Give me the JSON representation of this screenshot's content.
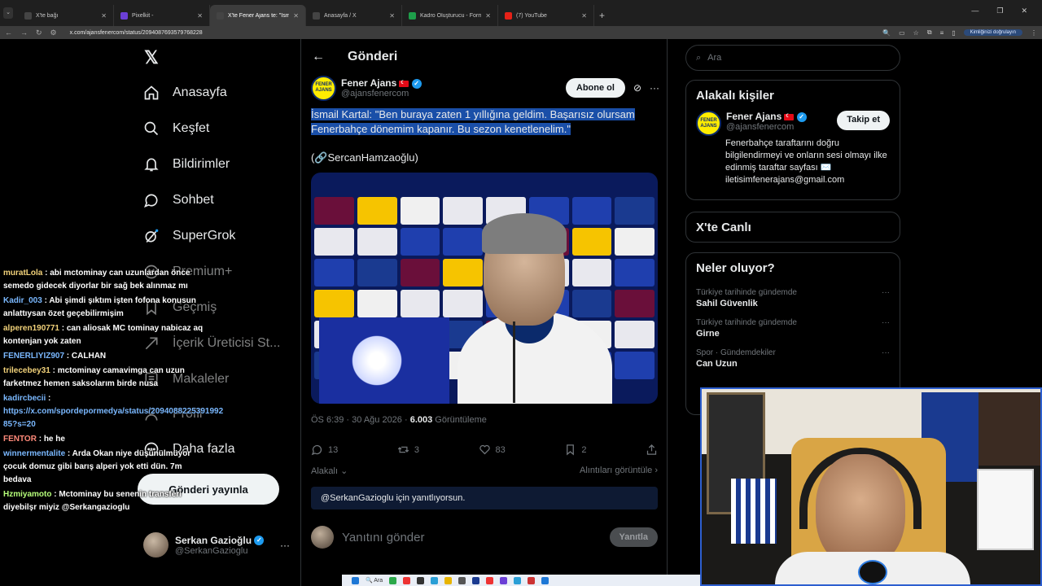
{
  "browser": {
    "tabs": [
      {
        "title": "X'te bağı",
        "color": "#222"
      },
      {
        "title": "Pixelkit -",
        "color": "#6b3fd6"
      },
      {
        "title": "X'te Fener Ajans te: \"İsmail Kart",
        "color": "#222"
      },
      {
        "title": "Anasayfa / X",
        "color": "#222"
      },
      {
        "title": "Kadro Oluşturucu - Formasyon",
        "color": "#1e9e4a"
      },
      {
        "title": "(7) YouTube",
        "color": "#e62117"
      }
    ],
    "new_tab": "+",
    "url": "x.com/ajansfenercom/status/2094087693579768228",
    "profile_label": "Kimliğinizi doğrulayın"
  },
  "nav": {
    "items": [
      {
        "label": "Anasayfa",
        "icon": "home-icon"
      },
      {
        "label": "Keşfet",
        "icon": "search-icon"
      },
      {
        "label": "Bildirimler",
        "icon": "bell-icon"
      },
      {
        "label": "Sohbet",
        "icon": "chat-icon"
      },
      {
        "label": "SuperGrok",
        "icon": "grok-icon"
      },
      {
        "label": "Premium+",
        "icon": "x-premium-icon"
      },
      {
        "label": "Geçmiş",
        "icon": "bookmark-icon"
      },
      {
        "label": "İçerik Üreticisi St...",
        "icon": "rocket-icon"
      },
      {
        "label": "Makaleler",
        "icon": "article-icon"
      },
      {
        "label": "Profil",
        "icon": "profile-icon"
      },
      {
        "label": "Daha fazla",
        "icon": "more-icon"
      }
    ],
    "post_button": "Gönderi yayınla",
    "account": {
      "name": "Serkan Gazioğlu",
      "handle": "@SerkanGazioglu",
      "more": "···"
    }
  },
  "chat": [
    {
      "user": "muratLola",
      "color": "#f2d27a",
      "text": "abi mctominay can uzunlardan önce semedo gidecek diyorlar bir sağ bek alınmaz mı"
    },
    {
      "user": "Kadir_003",
      "color": "#7ab8ff",
      "text": "Abi şimdi şıktım işten fofona konusun anlattıysan özet geçebilirmişim"
    },
    {
      "user": "alperen190771",
      "color": "#f2d27a",
      "text": "can aliosak MC tominay nabicaz aq kontenjan yok zaten"
    },
    {
      "user": "FENERLIYIZ907",
      "color": "#7ab8ff",
      "text": "CALHAN"
    },
    {
      "user": "trilecebey31",
      "color": "#f2d27a",
      "text": "mctominay camavimga can uzun farketmez hemen saksolarım birde nusa"
    },
    {
      "user": "kadircbecii",
      "color": "#7ab8ff",
      "text": "https://x.com/spordepormedya/status/2094088225391992​85?s=20"
    },
    {
      "user": "FENTOR",
      "color": "#ff8a7a",
      "text": "he he"
    },
    {
      "user": "winnermentalite",
      "color": "#7ab8ff",
      "text": "Arda Okan niye düşünülmüyor çocuk domuz gibi barış alperi yok etti dün. 7m bedava"
    },
    {
      "user": "Hzmiyamoto",
      "color": "#b6ff7a",
      "text": "Mctominay bu senenin transferi diyebilşr miyiz @Serkangazioglu"
    }
  ],
  "main": {
    "header_title": "Gönderi",
    "back": "←",
    "author_name": "Fener Ajans",
    "author_handle": "@ajansfenercom",
    "avatar_text": "FENER AJANS",
    "subscribe": "Abone ol",
    "tweet_text": "İsmail Kartal: \"Ben buraya zaten 1 yıllığına geldim. Başarısız olursam Fenerbahçe dönemim kapanır. Bu sezon kenetlenelim.\"",
    "source": "(🔗SercanHamzaoğlu)",
    "time": "ÖS 6:39 · 30 Ağu 2026 · ",
    "views": "6.003",
    "views_label": " Görüntüleme",
    "replies": "13",
    "reposts": "3",
    "likes": "83",
    "bookmarks": "2",
    "related": "Alakalı",
    "quotes": "Alıntıları görüntüle",
    "replying_to": "@SerkanGazioglu için yanıtlıyorsun.",
    "reply_placeholder": "Yanıtını gönder",
    "reply_button": "Yanıtla"
  },
  "right": {
    "search_placeholder": "Ara",
    "related_title": "Alakalı kişiler",
    "related_person": {
      "name": "Fener Ajans",
      "handle": "@ajansfenercom",
      "follow": "Takip et",
      "bio": "Fenerbahçe taraftarını doğru bilgilendirmeyi ve onların sesi olmayı ilke edinmiş taraftar sayfası ✉️ iletisimfenerajans@gmail.com"
    },
    "live_title": "X'te Canlı",
    "trends_title": "Neler oluyor?",
    "trends": [
      {
        "context": "Türkiye tarihinde gündemde",
        "name": "Sahil Güvenlik"
      },
      {
        "context": "Türkiye tarihinde gündemde",
        "name": "Girne"
      },
      {
        "context": "Spor · Gündemdekiler",
        "name": "Can Uzun"
      }
    ]
  },
  "taskbar": {
    "search": "Ara"
  }
}
